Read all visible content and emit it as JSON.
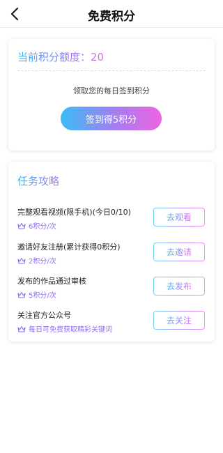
{
  "header": {
    "title": "免费积分",
    "back_icon": "chevron-left-icon"
  },
  "points": {
    "quota_label": "当前积分额度：20",
    "sign_hint": "领取您的每日签到积分",
    "sign_button": "签到得5积分"
  },
  "tasks_section": {
    "title": "任务攻略",
    "tasks": [
      {
        "title": "完整观看视频(限手机)(今日0/10)",
        "reward": "6积分/次",
        "button": "去观看"
      },
      {
        "title": "邀请好友注册(累计获得0积分)",
        "reward": "2积分/次",
        "button": "去邀请"
      },
      {
        "title": "发布的作品通过审核",
        "reward": "5积分/次",
        "button": "去发布"
      },
      {
        "title": "关注官方公众号",
        "reward": "每日可免费获取精彩关键词",
        "button": "去关注"
      }
    ]
  },
  "colors": {
    "gradient_start": "#3bbcf7",
    "gradient_end": "#f064e0"
  }
}
